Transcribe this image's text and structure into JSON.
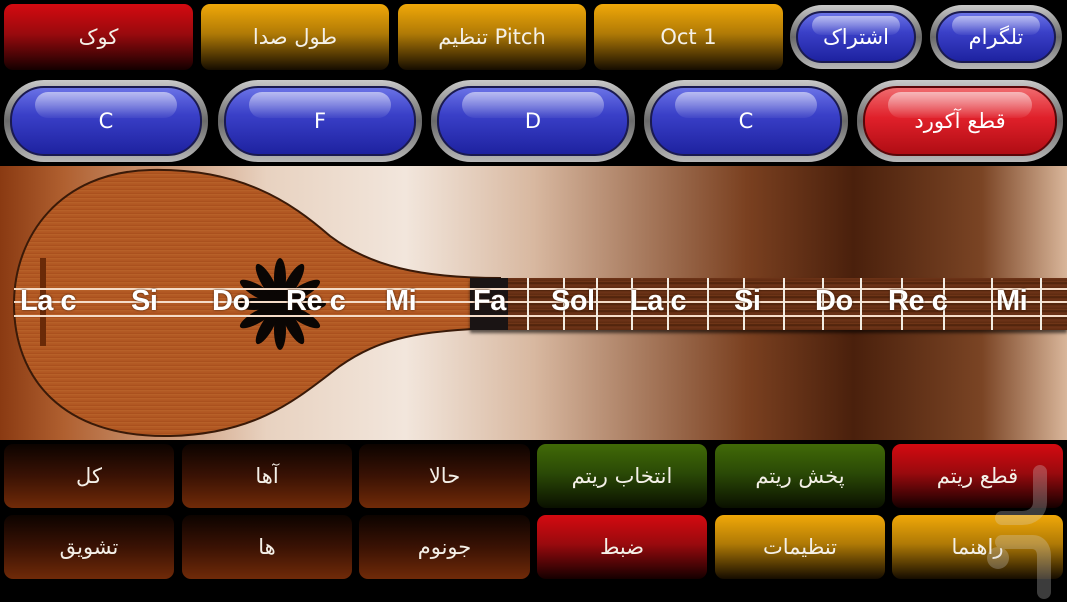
{
  "top_row": {
    "tune": "کوک",
    "sustain": "طول صدا",
    "pitch": "تنظیم Pitch",
    "octave": "Oct 1",
    "subscribe": "اشتراک",
    "telegram": "تلگرام"
  },
  "chord_row": {
    "chords": [
      "C",
      "F",
      "D",
      "C"
    ],
    "stop_chord": "قطع آکورد"
  },
  "instrument": {
    "body_notes": [
      {
        "label": "La c"
      },
      {
        "label": "Si"
      },
      {
        "label": "Do"
      },
      {
        "label": "Re c"
      },
      {
        "label": "Mi"
      },
      {
        "label": "Fa"
      }
    ],
    "neck_notes": [
      {
        "label": "Sol"
      },
      {
        "label": "La c"
      },
      {
        "label": "Si"
      },
      {
        "label": "Do"
      },
      {
        "label": "Re c"
      },
      {
        "label": "Mi"
      }
    ],
    "highlighted_note": "Fa"
  },
  "voice_buttons": {
    "row1": [
      "حالا",
      "آها",
      "کل"
    ],
    "row2": [
      "جونوم",
      "ها",
      "تشویق"
    ]
  },
  "control_buttons": {
    "select_rhythm": "انتخاب ریتم",
    "play_rhythm": "پخش ریتم",
    "stop_rhythm": "قطع ریتم",
    "record": "ضبط",
    "settings": "تنظیمات",
    "help": "راهنما"
  },
  "colors": {
    "red": "#d40a10",
    "gold": "#f0a808",
    "green": "#416a07",
    "blue": "#3a40c8",
    "brown": "#702a08"
  }
}
